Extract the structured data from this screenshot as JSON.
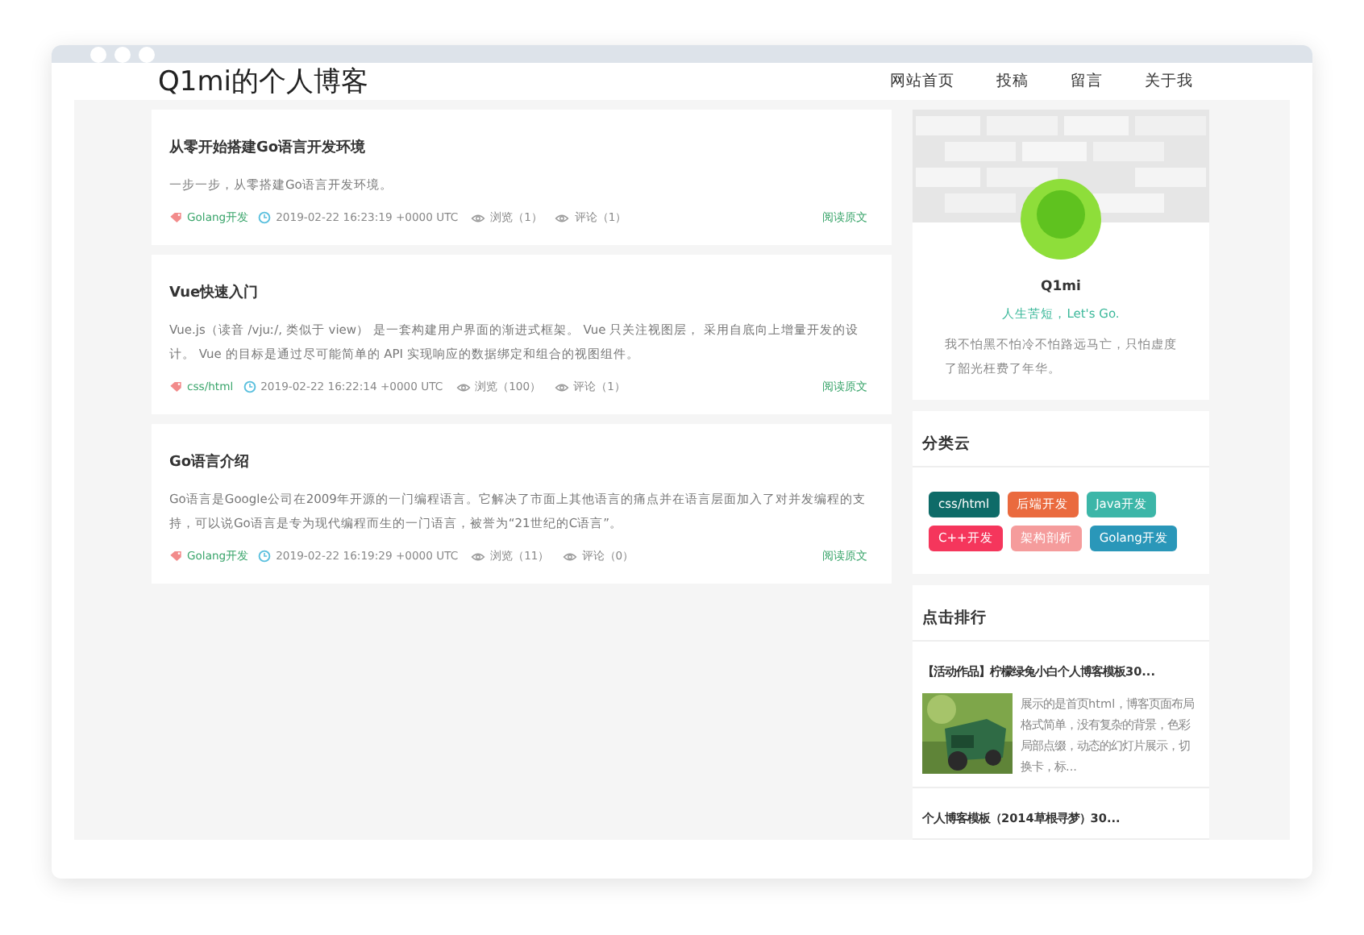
{
  "window": {
    "title": "Q1mi的个人博客"
  },
  "nav": [
    "网站首页",
    "投稿",
    "留言",
    "关于我"
  ],
  "posts": [
    {
      "title": "从零开始搭建Go语言开发环境",
      "summary": "一步一步，从零搭建Go语言开发环境。",
      "tag": "Golang开发",
      "time": "2019-02-22 16:23:19 +0000 UTC",
      "views": "浏览（1）",
      "comments": "评论（1）",
      "more": "阅读原文"
    },
    {
      "title": "Vue快速入门",
      "summary": "Vue.js（读音 /vjuː/, 类似于 view） 是一套构建用户界面的渐进式框架。 Vue 只关注视图层， 采用自底向上增量开发的设计。 Vue 的目标是通过尽可能简单的 API 实现响应的数据绑定和组合的视图组件。",
      "tag": "css/html",
      "time": "2019-02-22 16:22:14 +0000 UTC",
      "views": "浏览（100）",
      "comments": "评论（1）",
      "more": "阅读原文"
    },
    {
      "title": "Go语言介绍",
      "summary": "Go语言是Google公司在2009年开源的一门编程语言。它解决了市面上其他语言的痛点并在语言层面加入了对并发编程的支持，可以说Go语言是专为现代编程而生的一门语言，被誉为“21世纪的C语言”。",
      "tag": "Golang开发",
      "time": "2019-02-22 16:19:29 +0000 UTC",
      "views": "浏览（11）",
      "comments": "评论（0）",
      "more": "阅读原文"
    }
  ],
  "profile": {
    "name": "Q1mi",
    "motto": "人生苦短，Let's Go.",
    "bio": "我不怕黑不怕冷不怕路远马亡，只怕虚度了韶光枉费了年华。"
  },
  "categories": {
    "title": "分类云",
    "tags": [
      {
        "label": "css/html",
        "color": "#0e6b68"
      },
      {
        "label": "后端开发",
        "color": "#ea6a3e"
      },
      {
        "label": "Java开发",
        "color": "#3cb6a8"
      },
      {
        "label": "C++开发",
        "color": "#f5365c"
      },
      {
        "label": "架构剖析",
        "color": "#f59c9c"
      },
      {
        "label": "Golang开发",
        "color": "#2a97b9"
      }
    ]
  },
  "ranking": {
    "title": "点击排行",
    "items": [
      {
        "title": "【活动作品】柠檬绿兔小白个人博客模板30...",
        "summary": "展示的是首页html，博客页面布局格式简单，没有复杂的背景，色彩局部点缀，动态的幻灯片展示，切换卡，标..."
      },
      {
        "title": "个人博客模板（2014草根寻梦）30..."
      }
    ]
  }
}
